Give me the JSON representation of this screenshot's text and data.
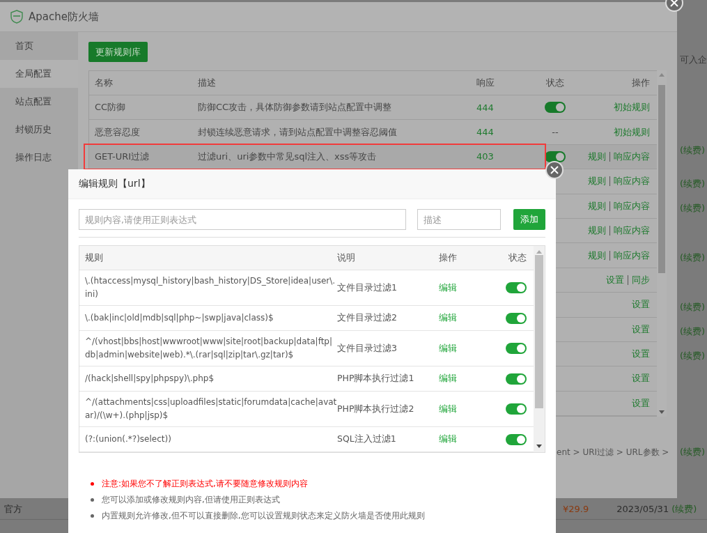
{
  "background_page": {
    "side_text": "可入企",
    "renew_links": [
      "(续费)",
      "(续费)",
      "(续费)",
      "(续费)",
      "(续费)",
      "(续费)",
      "(续费)",
      "(续费)"
    ],
    "bottom_row": {
      "source": "官方",
      "price": "¥29.9",
      "date": "2023/05/31",
      "renew": "(续费)"
    }
  },
  "firewall_window": {
    "title": "Apache防火墙",
    "sidebar": {
      "items": [
        {
          "label": "首页",
          "selected": false
        },
        {
          "label": "全局配置",
          "selected": true
        },
        {
          "label": "站点配置",
          "selected": false
        },
        {
          "label": "封锁历史",
          "selected": false
        },
        {
          "label": "操作日志",
          "selected": false
        }
      ]
    },
    "update_button": "更新规则库",
    "table": {
      "columns": [
        "名称",
        "描述",
        "响应",
        "状态",
        "操作"
      ],
      "rows": [
        {
          "name": "CC防御",
          "description": "防御CC攻击，具体防御参数请到站点配置中调整",
          "response": "444",
          "status": {
            "kind": "toggle",
            "on": true
          },
          "actions": [
            "初始规则"
          ],
          "highlighted": false
        },
        {
          "name": "恶意容忍度",
          "description": "封锁连续恶意请求，请到站点配置中调整容忍阈值",
          "response": "444",
          "status": {
            "kind": "text",
            "text": "--"
          },
          "actions": [
            "初始规则"
          ],
          "highlighted": false
        },
        {
          "name": "GET-URI过滤",
          "description": "过滤uri、uri参数中常见sql注入、xss等攻击",
          "response": "403",
          "status": {
            "kind": "toggle",
            "on": true
          },
          "actions": [
            "规则",
            "响应内容"
          ],
          "highlighted": true
        },
        {
          "actions": [
            "规则",
            "响应内容"
          ]
        },
        {
          "actions": [
            "规则",
            "响应内容"
          ]
        },
        {
          "actions": [
            "规则",
            "响应内容"
          ]
        },
        {
          "actions": [
            "规则",
            "响应内容"
          ]
        },
        {
          "actions": [
            "设置",
            "同步"
          ]
        },
        {
          "actions": [
            "设置"
          ]
        },
        {
          "actions": [
            "设置"
          ]
        },
        {
          "actions": [
            "设置"
          ]
        },
        {
          "actions": [
            "设置"
          ]
        },
        {
          "actions": [
            "设置"
          ]
        }
      ]
    },
    "breadcrumb": "ent > URI过滤 > URL参数 >"
  },
  "rule_dialog": {
    "title": "编辑规则【url】",
    "rule_field": {
      "placeholder": "规则内容,请使用正则表达式"
    },
    "description_field": {
      "placeholder": "描述"
    },
    "add_button": "添加",
    "table": {
      "columns": [
        "规则",
        "说明",
        "操作",
        "状态"
      ],
      "rows": [
        {
          "rule": "\\.(htaccess|mysql_history|bash_history|DS_Store|idea|user\\.ini)",
          "note": "文件目录过滤1",
          "action": "编辑",
          "on": true
        },
        {
          "rule": "\\.(bak|inc|old|mdb|sql|php~|swp|java|class)$",
          "note": "文件目录过滤2",
          "action": "编辑",
          "on": true
        },
        {
          "rule": "^/(vhost|bbs|host|wwwroot|www|site|root|backup|data|ftp|db|admin|website|web).*\\.(rar|sql|zip|tar\\.gz|tar)$",
          "note": "文件目录过滤3",
          "action": "编辑",
          "on": true
        },
        {
          "rule": "/(hack|shell|spy|phpspy)\\.php$",
          "note": "PHP脚本执行过滤1",
          "action": "编辑",
          "on": true
        },
        {
          "rule": "^/(attachments|css|uploadfiles|static|forumdata|cache|avatar)/(\\w+).(php|jsp)$",
          "note": "PHP脚本执行过滤2",
          "action": "编辑",
          "on": true
        },
        {
          "rule": "(?:(union(.*?)select))",
          "note": "SQL注入过滤1",
          "action": "编辑",
          "on": true
        }
      ]
    },
    "notes": [
      {
        "kind": "warning",
        "text": "注意:如果您不了解正则表达式,请不要随意修改规则内容"
      },
      {
        "kind": "info",
        "text": "您可以添加或修改规则内容,但请使用正则表达式"
      },
      {
        "kind": "info",
        "text": "内置规则允许修改,但不可以直接删除,您可以设置规则状态来定义防火墙是否使用此规则"
      }
    ]
  }
}
